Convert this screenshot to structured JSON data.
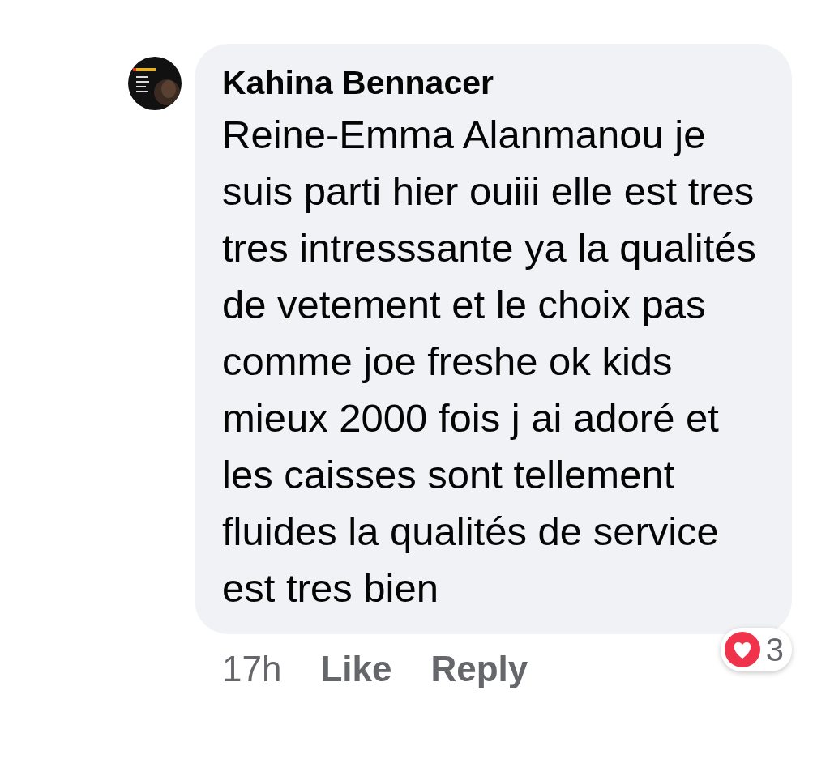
{
  "comment": {
    "author": "Kahina Bennacer",
    "text": "Reine-Emma Alanmanou je suis parti hier ouiii elle est tres tres intresssante ya la qualités de vetement et le choix pas comme joe freshe ok kids mieux 2000 fois j ai adoré et les caisses sont tellement fluides la qualités de service est tres bien",
    "time": "17h",
    "actions": [
      {
        "label": "Like"
      },
      {
        "label": "Reply"
      }
    ],
    "reactions": {
      "count": "3"
    }
  }
}
